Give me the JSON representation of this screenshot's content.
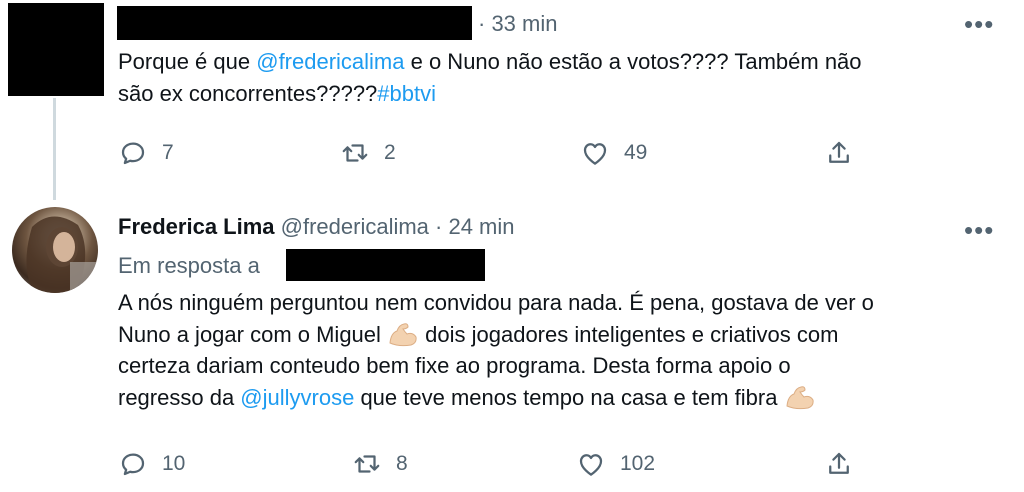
{
  "tweet1": {
    "time": "· 33 min",
    "more": "•••",
    "text_part1": "Porque é que ",
    "mention": "@fredericalima",
    "text_part2": " e o Nuno não estão a votos???? Também não",
    "text_line2": "são ex concorrentes?????",
    "hashtag": "#bbtvi",
    "replies": "7",
    "retweets": "2",
    "likes": "49"
  },
  "tweet2": {
    "name": "Frederica Lima",
    "handle": "@fredericalima",
    "time": "· 24 min",
    "more": "•••",
    "reply_to_label": "Em resposta a",
    "line1": "A nós ninguém perguntou nem convidou para nada. É pena, gostava de ver o",
    "line2a": "Nuno a jogar com o Miguel ",
    "line2b": " dois jogadores inteligentes e criativos com",
    "line3": "certeza dariam conteudo bem fixe ao programa. Desta forma apoio o",
    "line4a": "regresso da ",
    "mention": "@jullyvrose",
    "line4b": " que teve menos tempo na casa e tem fibra ",
    "replies": "10",
    "retweets": "8",
    "likes": "102"
  },
  "icons": [
    "reply-icon",
    "retweet-icon",
    "like-icon",
    "share-icon",
    "flexed-biceps-icon",
    "more-icon"
  ],
  "colors": {
    "link": "#1d9bf0",
    "muted": "#536471",
    "text": "#0f1419",
    "redaction": "#000000"
  }
}
